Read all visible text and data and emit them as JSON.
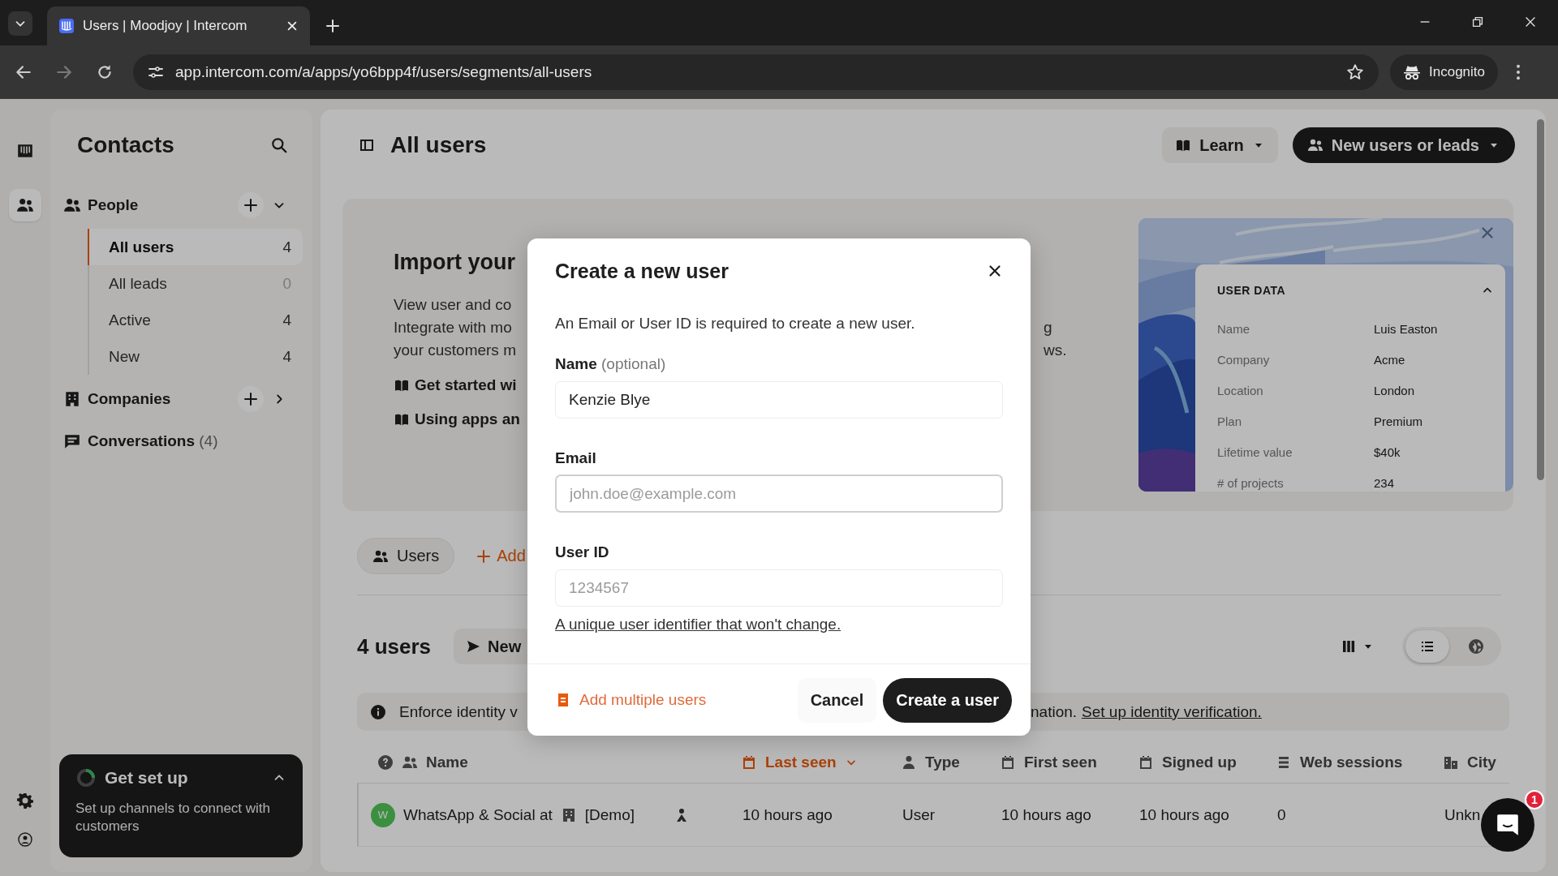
{
  "browser": {
    "tab_title": "Users | Moodjoy | Intercom",
    "url": "app.intercom.com/a/apps/yo6bpp4f/users/segments/all-users",
    "profile": "Incognito"
  },
  "rail": [
    {
      "kind": "inbox",
      "selected": false
    },
    {
      "kind": "contacts",
      "selected": true
    }
  ],
  "sidebar": {
    "title": "Contacts",
    "groups": [
      {
        "kind": "people",
        "label": "People",
        "expanded": true,
        "items": [
          {
            "label": "All users",
            "count": "4",
            "selected": true,
            "muted": false
          },
          {
            "label": "All leads",
            "count": "0",
            "selected": false,
            "muted": true
          },
          {
            "label": "Active",
            "count": "4",
            "selected": false,
            "muted": false
          },
          {
            "label": "New",
            "count": "4",
            "selected": false,
            "muted": false
          }
        ]
      },
      {
        "kind": "companies",
        "label": "Companies",
        "expanded": false
      },
      {
        "kind": "conversations",
        "label": "Conversations",
        "count": "(4)"
      }
    ]
  },
  "setup": {
    "title": "Get set up",
    "text": "Set up channels to connect with customers",
    "expanded": true
  },
  "header": {
    "title": "All users",
    "learn": "Learn",
    "primary": "New users or leads"
  },
  "import_banner": {
    "heading": "Import your",
    "lines": [
      {
        "left": "View user and co"
      },
      {
        "left": "Integrate with mo",
        "right": "g"
      },
      {
        "left": "your customers m",
        "right": "ws."
      }
    ],
    "links": [
      "Get started wi",
      "Using apps an"
    ],
    "preview": {
      "kind": "picture",
      "title": "USER DATA",
      "expanded": true,
      "rows": [
        {
          "label": "Name",
          "value": "Luis Easton"
        },
        {
          "label": "Company",
          "value": "Acme"
        },
        {
          "label": "Location",
          "value": "London"
        },
        {
          "label": "Plan",
          "value": "Premium"
        },
        {
          "label": "Lifetime value",
          "value": "$40k"
        },
        {
          "label": "# of projects",
          "value": "234"
        }
      ]
    }
  },
  "view_tabs": [
    {
      "label": "Users",
      "selected": true
    }
  ],
  "add_label": "Add",
  "list_header": {
    "count": "4 users",
    "new_label": "New"
  },
  "view_modes": [
    {
      "kind": "list",
      "selected": true
    },
    {
      "kind": "map",
      "selected": false
    }
  ],
  "notice": {
    "lead": "Enforce identity v",
    "tail": "nation.",
    "link": "Set up identity verification."
  },
  "table": {
    "columns": [
      {
        "kind": "name",
        "label": "Name",
        "sorted": false
      },
      {
        "kind": "last_seen",
        "label": "Last seen",
        "sorted": true
      },
      {
        "kind": "type",
        "label": "Type",
        "sorted": false
      },
      {
        "kind": "first_seen",
        "label": "First seen",
        "sorted": false
      },
      {
        "kind": "signed_up",
        "label": "Signed up",
        "sorted": false
      },
      {
        "kind": "web_sessions",
        "label": "Web sessions",
        "sorted": false
      },
      {
        "kind": "city",
        "label": "City",
        "sorted": false
      }
    ],
    "rows": [
      {
        "avatar": "W",
        "name": "WhatsApp & Social at",
        "company": "[Demo]",
        "last_seen": "10 hours ago",
        "type": "User",
        "first_seen": "10 hours ago",
        "signed_up": "10 hours ago",
        "web_sessions": "0",
        "city": "Unkn"
      }
    ]
  },
  "messenger": {
    "badge": "1"
  },
  "modal": {
    "title": "Create a new user",
    "description": "An Email or User ID is required to create a new user.",
    "fields": [
      {
        "label": "Name",
        "hint": "(optional)",
        "value": "Kenzie Blye",
        "focused": false
      },
      {
        "label": "Email",
        "placeholder": "john.doe@example.com",
        "focused": true
      },
      {
        "label": "User ID",
        "placeholder": "1234567",
        "focused": false,
        "help": "A unique user identifier that won't change."
      }
    ],
    "secondary_action": "Add multiple users",
    "cancel": "Cancel",
    "submit": "Create a user"
  }
}
